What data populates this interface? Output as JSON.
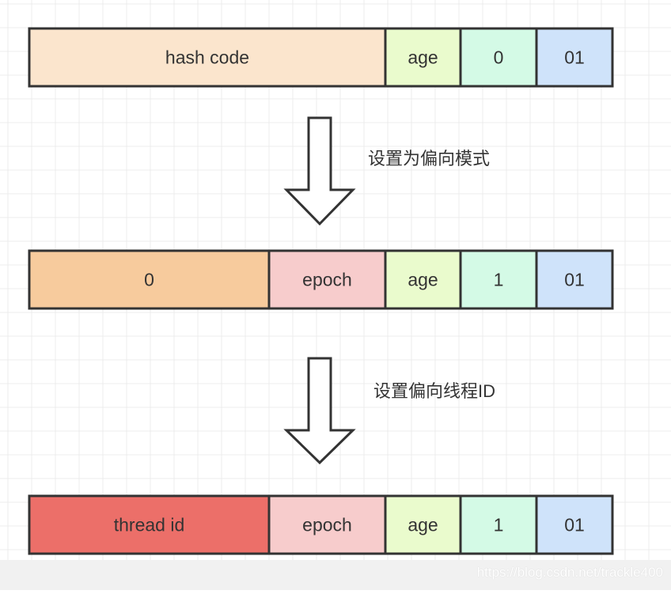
{
  "rows": [
    {
      "cells": [
        {
          "label": "hash code",
          "color": "#fbe5cd"
        },
        {
          "label": "age",
          "color": "#eafbcd"
        },
        {
          "label": "0",
          "color": "#d4fae6"
        },
        {
          "label": "01",
          "color": "#cfe3fa"
        }
      ]
    },
    {
      "cells": [
        {
          "label": "0",
          "color": "#f7cb9d"
        },
        {
          "label": "epoch",
          "color": "#f7cccc"
        },
        {
          "label": "age",
          "color": "#eafbcd"
        },
        {
          "label": "1",
          "color": "#d4fae6"
        },
        {
          "label": "01",
          "color": "#cfe3fa"
        }
      ]
    },
    {
      "cells": [
        {
          "label": "thread id",
          "color": "#ec6f69"
        },
        {
          "label": "epoch",
          "color": "#f7cccc"
        },
        {
          "label": "age",
          "color": "#eafbcd"
        },
        {
          "label": "1",
          "color": "#d4fae6"
        },
        {
          "label": "01",
          "color": "#cfe3fa"
        }
      ]
    }
  ],
  "arrows": [
    {
      "label": "设置为偏向模式"
    },
    {
      "label": "设置偏向线程ID"
    }
  ],
  "watermark": "https://blog.csdn.net/trackle400"
}
